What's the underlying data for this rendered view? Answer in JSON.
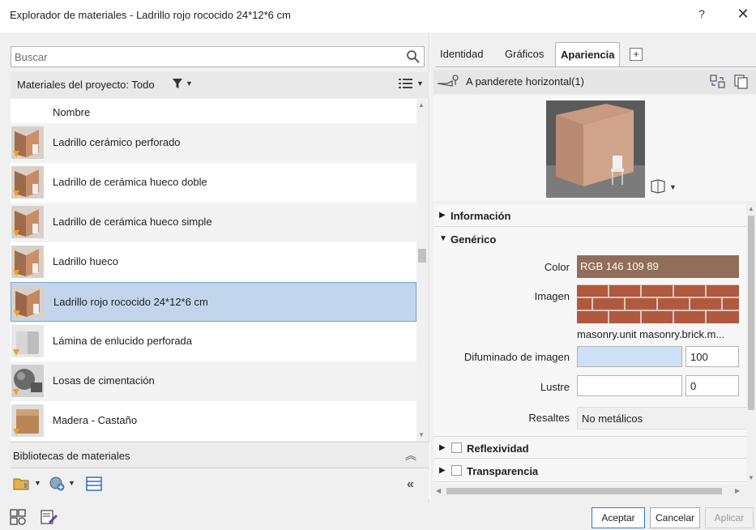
{
  "window": {
    "title": "Explorador de materiales - Ladrillo rojo rococido 24*12*6 cm",
    "help_label": "?",
    "close_label": "✕"
  },
  "search": {
    "placeholder": "Buscar",
    "value": ""
  },
  "project_bar": {
    "label": "Materiales del proyecto: Todo"
  },
  "materials": {
    "column_header": "Nombre",
    "items": [
      {
        "name": "Ladrillo cerámico perforado",
        "thumb": "brick-thumb",
        "selected": false
      },
      {
        "name": "Ladrillo de cerámica hueco doble",
        "thumb": "brick-thumb",
        "selected": false
      },
      {
        "name": "Ladrillo de cerámica hueco simple",
        "thumb": "brick-thumb",
        "selected": false
      },
      {
        "name": "Ladrillo hueco",
        "thumb": "brick-thumb",
        "selected": false
      },
      {
        "name": "Ladrillo rojo rococido 24*12*6 cm",
        "thumb": "brick-thumb",
        "selected": true
      },
      {
        "name": "Lámina de enlucido perforada",
        "thumb": "plaster-thumb",
        "selected": false
      },
      {
        "name": "Losas de cimentación",
        "thumb": "concrete-thumb",
        "selected": false
      },
      {
        "name": "Madera - Castaño",
        "thumb": "wood-thumb",
        "selected": false
      }
    ]
  },
  "libraries": {
    "label": "Bibliotecas de materiales"
  },
  "tabs": [
    {
      "label": "Identidad",
      "active": false
    },
    {
      "label": "Gráficos",
      "active": false
    },
    {
      "label": "Apariencia",
      "active": true
    }
  ],
  "tab_add_label": "+",
  "asset": {
    "name": "A panderete horizontal(1)"
  },
  "sections": {
    "informacion": "Información",
    "generico": "Genérico",
    "reflexividad": "Reflexividad",
    "transparencia": "Transparencia"
  },
  "properties": {
    "color_label": "Color",
    "color_value": "RGB 146 109 89",
    "color_hex": "#926d59",
    "image_label": "Imagen",
    "image_caption": "masonry.unit masonry.brick.m...",
    "fade_label": "Difuminado de imagen",
    "fade_value": "100",
    "gloss_label": "Lustre",
    "gloss_value": "0",
    "highlights_label": "Resaltes",
    "highlights_value": "No metálicos"
  },
  "buttons": {
    "accept": "Aceptar",
    "cancel": "Cancelar",
    "apply": "Aplicar"
  },
  "colors": {
    "selection_bg": "#c2d5ec",
    "selection_border": "#7aa3d3",
    "accent_border": "#2f7bd3"
  }
}
